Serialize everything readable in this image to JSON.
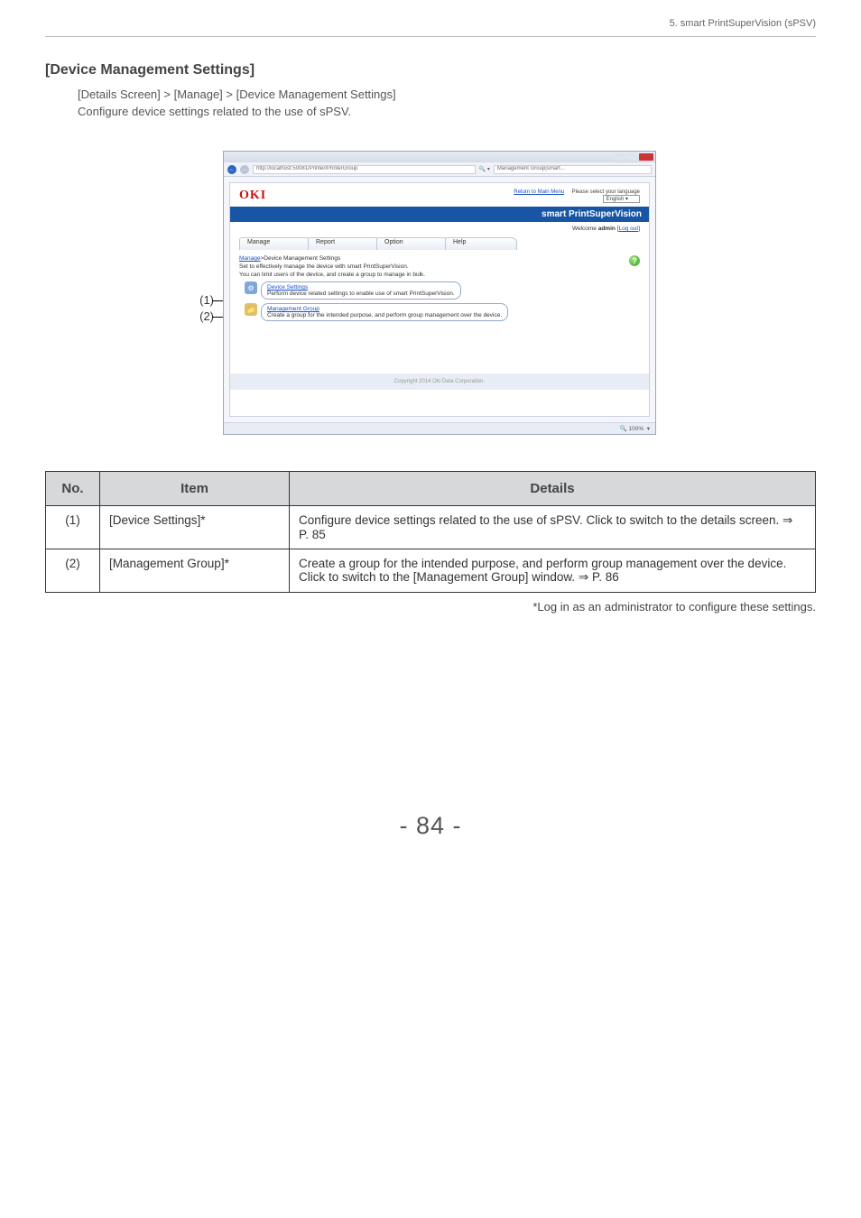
{
  "header_right": "5. smart PrintSuperVision (sPSV)",
  "title": "[Device Management Settings]",
  "para_line1": "[Details Screen] > [Manage] > [Device Management Settings]",
  "para_line2": "Configure device settings related to the use of sPSV.",
  "callouts": {
    "c1": "(1)",
    "c2": "(2)"
  },
  "screenshot": {
    "url": "http://localhost:50081/Printer/PrinterGroup",
    "addr_suffix": "Management Group|smart…",
    "logo": "OKI",
    "return_link": "Return to Main Menu",
    "lang_label": "Please select your language",
    "lang_value": "English",
    "app_banner": "smart PrintSuperVision",
    "welcome_prefix": "Welcome ",
    "welcome_user": "admin",
    "welcome_logout": "Log out",
    "menus": {
      "m1": "Manage",
      "m2": "Report",
      "m3": "Option",
      "m4": "Help"
    },
    "bc_manage": "Manage",
    "bc_current": ">Device Management Settings",
    "desc1": "Set to effectively manage the device with smart PrintSuperVision.",
    "desc2": "You can limit users of the device, and create a group to manage in bulk.",
    "help_q": "?",
    "row1_title": "Device Settings",
    "row1_desc": "Perform device related settings to enable use of smart PrintSuperVision.",
    "row2_title": "Management Group",
    "row2_desc": "Create a group for the intended purpose, and perform group management over the device.",
    "copyright": "Copyright 2014 Oki Data Corporation.",
    "zoom": "100%"
  },
  "table": {
    "head": {
      "no": "No.",
      "item": "Item",
      "details": "Details"
    },
    "rows": [
      {
        "no": "(1)",
        "item": "[Device Settings]*",
        "details": "Configure device settings related to the use of sPSV. Click to switch to the details screen. ⇒ P. 85"
      },
      {
        "no": "(2)",
        "item": "[Management Group]*",
        "details": "Create a group for the intended purpose, and perform group management over the device.\nClick to switch to the [Management Group] window. ⇒ P. 86"
      }
    ]
  },
  "footnote": "*Log in as an administrator to configure these settings.",
  "page_number": "- 84 -"
}
